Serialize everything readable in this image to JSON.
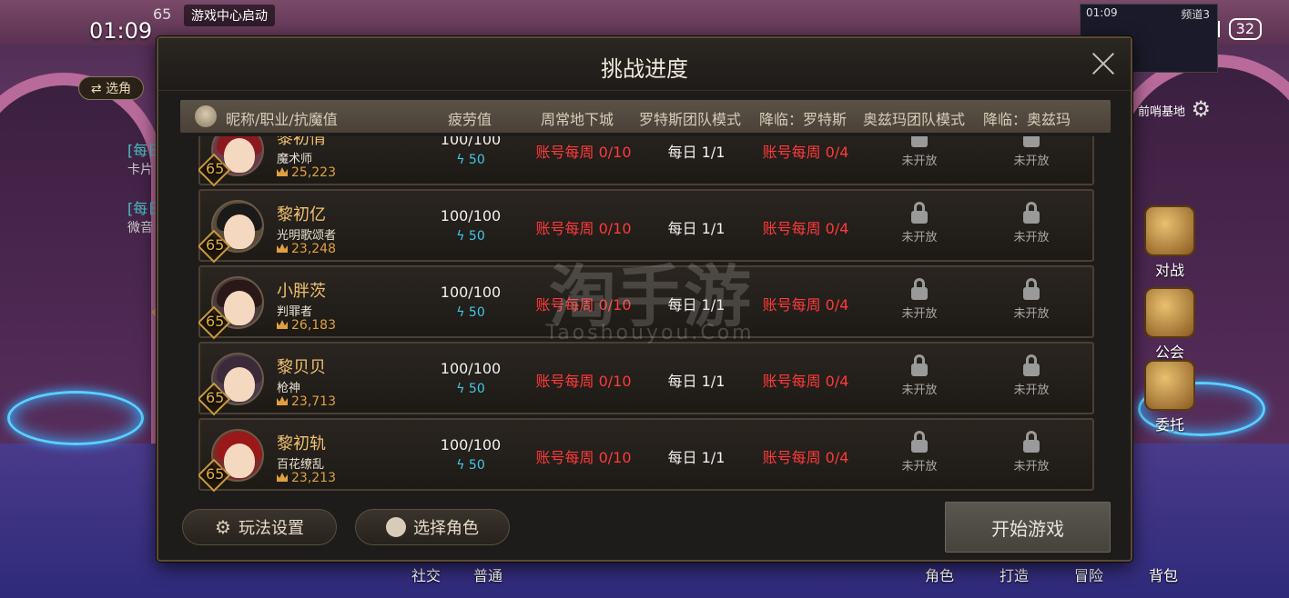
{
  "status_bar": {
    "time": "01:09",
    "battery": "32"
  },
  "hud": {
    "level": "65",
    "launch_text": "游戏中心启动",
    "select_label": "⇄ 选角",
    "mini_window": {
      "time": "01:09",
      "channel": "频道3",
      "location": "前哨基地"
    },
    "chat": [
      {
        "tag": "[每日",
        "sub": "卡片"
      },
      {
        "tag": "[每日",
        "sub": "微音"
      }
    ],
    "side_buttons": [
      "对战",
      "公会",
      "委托"
    ],
    "bottom_nav": [
      "社交",
      "普通",
      "角色",
      "打造",
      "冒险",
      "背包"
    ]
  },
  "modal": {
    "title": "挑战进度",
    "columns": {
      "name": "昵称/职业/抗魔值",
      "fatigue": "疲劳值",
      "weekly_dungeon": "周常地下城",
      "lotus_raid": "罗特斯团队模式",
      "lotus_descent": "降临：罗特斯",
      "ozma_raid": "奥兹玛团队模式",
      "ozma_descent": "降临：奥兹玛"
    },
    "rows": [
      {
        "level": "65",
        "name": "黎初情",
        "job": "魔术师",
        "power": "25,223",
        "fatigue": "100/100",
        "bolt": "50",
        "weekly": "账号每周 0/10",
        "daily": "每日 1/1",
        "account": "账号每周 0/4",
        "locked1": "未开放",
        "locked2": "未开放",
        "hair": "#8a1a20"
      },
      {
        "level": "65",
        "name": "黎初亿",
        "job": "光明歌颂者",
        "power": "23,248",
        "fatigue": "100/100",
        "bolt": "50",
        "weekly": "账号每周 0/10",
        "daily": "每日 1/1",
        "account": "账号每周 0/4",
        "locked1": "未开放",
        "locked2": "未开放",
        "hair": "#1a1a1a"
      },
      {
        "level": "65",
        "name": "小胖茨",
        "job": "判罪者",
        "power": "26,183",
        "fatigue": "100/100",
        "bolt": "50",
        "weekly": "账号每周 0/10",
        "daily": "每日 1/1",
        "account": "账号每周 0/4",
        "locked1": "未开放",
        "locked2": "未开放",
        "hair": "#2a1818"
      },
      {
        "level": "65",
        "name": "黎贝贝",
        "job": "枪神",
        "power": "23,713",
        "fatigue": "100/100",
        "bolt": "50",
        "weekly": "账号每周 0/10",
        "daily": "每日 1/1",
        "account": "账号每周 0/4",
        "locked1": "未开放",
        "locked2": "未开放",
        "hair": "#3a2a3a"
      },
      {
        "level": "65",
        "name": "黎初轨",
        "job": "百花缭乱",
        "power": "23,213",
        "fatigue": "100/100",
        "bolt": "50",
        "weekly": "账号每周 0/10",
        "daily": "每日 1/1",
        "account": "账号每周 0/4",
        "locked1": "未开放",
        "locked2": "未开放",
        "hair": "#9a1818"
      }
    ],
    "watermark": "淘手游",
    "watermark_sub": "Taoshouyou.Com",
    "buttons": {
      "settings": "玩法设置",
      "select_role": "选择角色",
      "start": "开始游戏"
    }
  }
}
